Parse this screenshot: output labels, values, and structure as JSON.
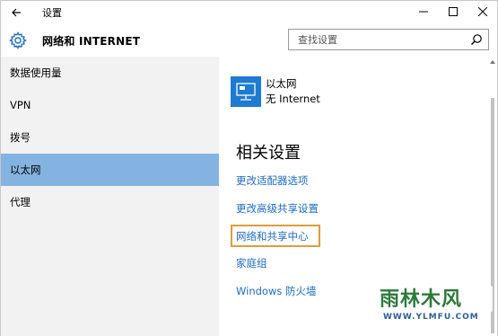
{
  "window": {
    "title": "设置",
    "header_title": "网络和 INTERNET"
  },
  "search": {
    "placeholder": "查找设置"
  },
  "sidebar": {
    "items": [
      {
        "label": "数据使用量",
        "selected": false
      },
      {
        "label": "VPN",
        "selected": false
      },
      {
        "label": "拨号",
        "selected": false
      },
      {
        "label": "以太网",
        "selected": true
      },
      {
        "label": "代理",
        "selected": false
      }
    ]
  },
  "content": {
    "connection_name": "以太网",
    "connection_status": "无 Internet",
    "section_heading": "相关设置",
    "links": [
      "更改适配器选项",
      "更改高级共享设置",
      "网络和共享中心",
      "家庭组",
      "Windows 防火墙"
    ],
    "highlighted_link_index": 2
  },
  "watermark": {
    "logo": "雨林木风",
    "url": "WWW.YLMFU.COM"
  },
  "colors": {
    "selected_bg": "#85b3e1",
    "link": "#1e6bc1",
    "highlight_border": "#e59a3c",
    "ethernet_icon_bg": "#1e7bd2",
    "sidebar_bg": "#f2f2f2"
  }
}
